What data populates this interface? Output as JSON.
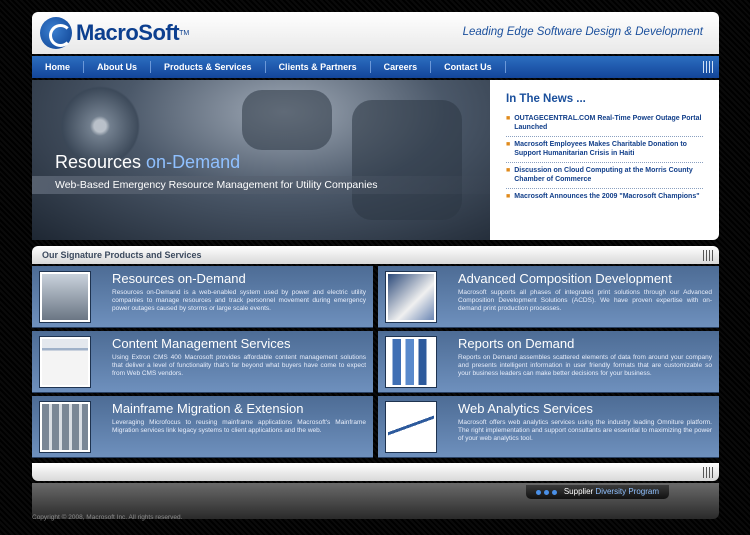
{
  "header": {
    "logo_text": "MacroSoft",
    "logo_tm": "TM",
    "tagline": "Leading Edge Software Design & Development"
  },
  "nav": {
    "items": [
      "Home",
      "About Us",
      "Products & Services",
      "Clients & Partners",
      "Careers",
      "Contact Us"
    ]
  },
  "hero": {
    "title_main": "Resources ",
    "title_accent": "on-Demand",
    "subtitle": "Web-Based Emergency Resource Management for Utility Companies"
  },
  "news": {
    "title": "In The News ...",
    "items": [
      "OUTAGECENTRAL.COM Real-Time Power Outage Portal Launched",
      "Macrosoft Employees Makes Charitable Donation to Support Humanitarian Crisis in Haiti",
      "Discussion on Cloud Computing at the Morris County Chamber of Commerce",
      "Macrosoft Announces the 2009 \"Macrosoft Champions\""
    ]
  },
  "signature": {
    "title": "Our Signature Products and Services"
  },
  "products": [
    {
      "title": "Resources on-Demand",
      "text": "Resources on-Demand is a web-enabled system used by power and electric utility companies to manage resources and track personnel movement during emergency power outages caused by storms or large scale events.",
      "icon": "people-icon"
    },
    {
      "title": "Advanced Composition Development",
      "text": "Macrosoft supports all phases of integrated print solutions through our Advanced Composition Development Solutions (ACDS). We have proven expertise with on-demand print production processes.",
      "icon": "documents-icon"
    },
    {
      "title": "Content Management Services",
      "text": "Using Extron CMS 400 Macrosoft provides affordable content management solutions that deliver a level of functionality that's far beyond what buyers have come to expect from Web CMS vendors.",
      "icon": "browser-window-icon"
    },
    {
      "title": "Reports on Demand",
      "text": "Reports on Demand assembles scattered elements of data from around your company and presents intelligent information in user friendly formats that are customizable so your business leaders can make better decisions for your business.",
      "icon": "bar-chart-icon"
    },
    {
      "title": "Mainframe Migration & Extension",
      "text": "Leveraging Microfocus to reusing mainframe applications Macrosoft's Mainframe Migration services link legacy systems to client applications and the web.",
      "icon": "server-racks-icon"
    },
    {
      "title": "Web Analytics Services",
      "text": "Macrosoft offers web analytics services using the industry leading Omniture platform. The right implementation and support consultants are essential to maximizing the power of your web analytics tool.",
      "icon": "line-graph-icon"
    }
  ],
  "supplier": {
    "label_main": "Supplier ",
    "label_accent": "Diversity Program"
  },
  "footer": {
    "copyright": "Copyright © 2008, Macrosoft Inc.  All rights reserved."
  },
  "colors": {
    "brand_blue": "#13459a",
    "accent_orange": "#e08a1c",
    "product_panel": "#5f80aa"
  }
}
